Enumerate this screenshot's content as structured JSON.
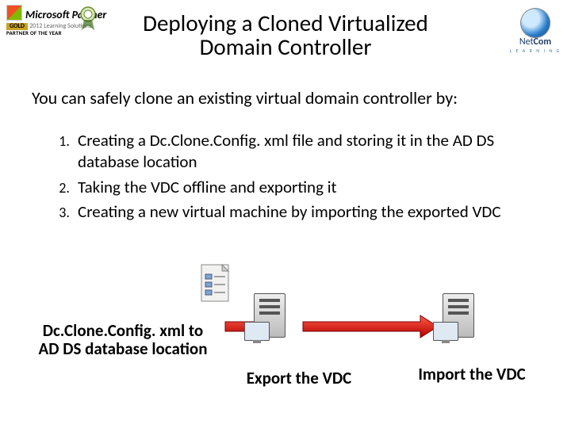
{
  "header": {
    "ms_partner": "Microsoft Partner",
    "gold": "GOLD",
    "tagline": "2012 Learning Solutions",
    "poy": "PARTNER OF THE YEAR",
    "netcom_brand": "Net",
    "netcom_brand2": "Com",
    "netcom_sub": "L E A R N I N G"
  },
  "title": "Deploying a Cloned Virtualized\nDomain Controller",
  "intro": "You can safely clone an existing virtual domain controller by:",
  "steps": [
    "Creating a  Dc.Clone.Config. xml file and storing it in the AD DS database location",
    "Taking the VDC offline and exporting it",
    "Creating a new virtual machine by importing the exported VDC"
  ],
  "captions": {
    "c1": "Dc.Clone.Config. xml to AD DS database location",
    "c2": "Export the VDC",
    "c3": "Import the VDC"
  },
  "colors": {
    "arrow": "#d41f1f"
  }
}
